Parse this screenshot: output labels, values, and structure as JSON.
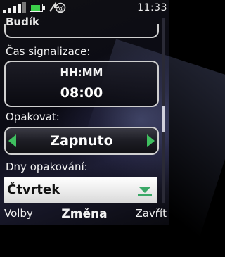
{
  "status_bar": {
    "clock": "11:33",
    "signal_icon": "signal-strength-icon",
    "battery_icon": "battery-icon",
    "network_icon": "packet-data-icon",
    "signal_level": 4,
    "battery_level": 0.7
  },
  "header": {
    "title": "Budík"
  },
  "alarm_time": {
    "label": "Čas signalizace:",
    "format": "HH:MM",
    "value": "08:00"
  },
  "repeat": {
    "label": "Opakovat:",
    "value": "Zapnuto",
    "left_arrow_icon": "arrow-left-icon",
    "right_arrow_icon": "arrow-right-icon",
    "arrow_color": "#3fbf5f"
  },
  "repeat_days": {
    "label": "Dny opakování:",
    "value": "Čtvrtek",
    "dropdown_icon": "dropdown-arrow-icon"
  },
  "softkeys": {
    "left": "Volby",
    "middle": "Změna",
    "right": "Zavřít"
  }
}
